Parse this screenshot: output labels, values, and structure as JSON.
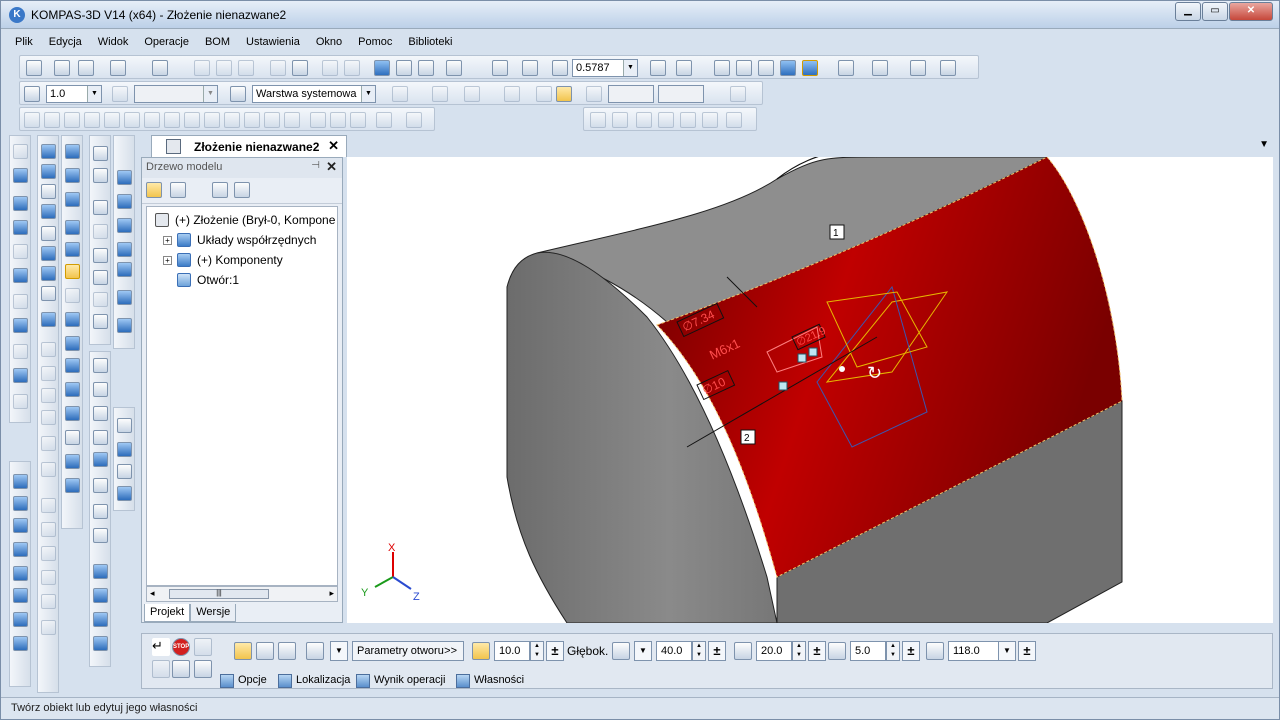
{
  "window": {
    "title": "KOMPAS-3D V14 (x64) - Złożenie nienazwane2",
    "app_icon": "K",
    "minimize": "▁",
    "maximize": "▭",
    "close": "✕"
  },
  "menu": [
    "Plik",
    "Edycja",
    "Widok",
    "Operacje",
    "BOM",
    "Ustawienia",
    "Okno",
    "Pomoc",
    "Biblioteki"
  ],
  "toolbar": {
    "zoom_value": "0.5787",
    "step_value": "1.0",
    "layer_value": "Warstwa systemowa"
  },
  "document_tab": {
    "title": "Złożenie nienazwane2",
    "close": "✕",
    "dropdown": "▼"
  },
  "model_tree": {
    "header": "Drzewo modelu",
    "pin": "⊣",
    "close": "✕",
    "items": [
      {
        "label": "(+) Złożenie (Brył-0, Kompone",
        "expand": ""
      },
      {
        "label": "Układy współrzędnych",
        "expand": "+"
      },
      {
        "label": "(+) Komponenty",
        "expand": "+"
      },
      {
        "label": "Otwór:1",
        "expand": ""
      }
    ],
    "scroll_thumb": "|||",
    "scroll_left": "◂",
    "scroll_right": "▸",
    "tabs": [
      "Projekt",
      "Wersje"
    ]
  },
  "viewport": {
    "accent": "#c00000",
    "body_color": "#808080",
    "markers": [
      "1",
      "2"
    ],
    "dimension_texts": [
      "∅7.34",
      "M6x1",
      "∅10",
      "∅21.9"
    ],
    "axes": {
      "x": "X",
      "y": "Y",
      "z": "Z"
    }
  },
  "properties": {
    "stop": "STOP",
    "hole_params": "Parametry otworu",
    "more": ">>",
    "diameter": "10.0",
    "depth_label": "Głębok.",
    "depth": "40.0",
    "v2": "20.0",
    "v3": "5.0",
    "angle": "118.0",
    "tabs": [
      "Opcje",
      "Lokalizacja",
      "Wynik operacji",
      "Własności"
    ]
  },
  "status": "Twórz obiekt lub edytuj jego własności"
}
